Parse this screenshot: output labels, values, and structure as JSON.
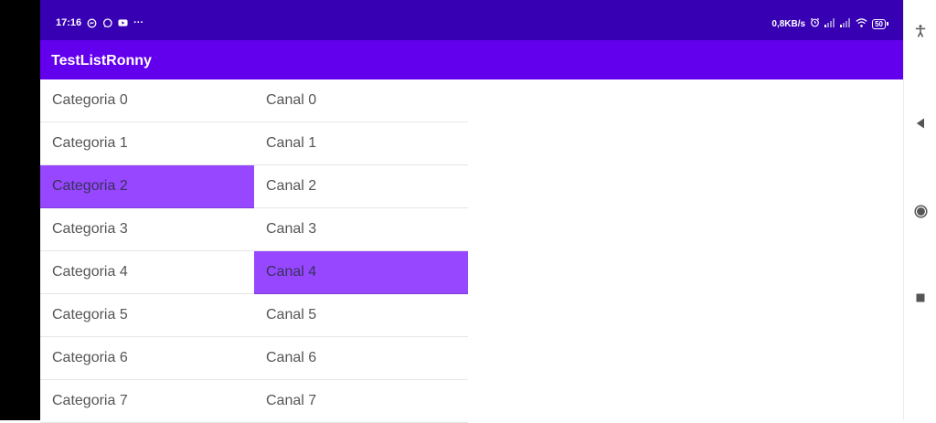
{
  "status_bar": {
    "time": "17:16",
    "overflow": "···",
    "net_speed": "0,8KB/s",
    "battery": "50",
    "icons_left": [
      "messenger-icon",
      "whatsapp-icon",
      "youtube-icon"
    ],
    "icons_right": [
      "alarm-icon",
      "signal-icon",
      "signal-icon",
      "wifi-icon",
      "battery-icon"
    ]
  },
  "app_bar": {
    "title": "TestListRonny",
    "color": "#6200ee"
  },
  "lists": {
    "selected_color": "#9747ff",
    "categories": [
      {
        "label": "Categoria 0",
        "selected": false
      },
      {
        "label": "Categoria 1",
        "selected": false
      },
      {
        "label": "Categoria 2",
        "selected": true
      },
      {
        "label": "Categoria 3",
        "selected": false
      },
      {
        "label": "Categoria 4",
        "selected": false
      },
      {
        "label": "Categoria 5",
        "selected": false
      },
      {
        "label": "Categoria 6",
        "selected": false
      },
      {
        "label": "Categoria 7",
        "selected": false
      }
    ],
    "canals": [
      {
        "label": "Canal 0",
        "selected": false
      },
      {
        "label": "Canal 1",
        "selected": false
      },
      {
        "label": "Canal 2",
        "selected": false
      },
      {
        "label": "Canal 3",
        "selected": false
      },
      {
        "label": "Canal 4",
        "selected": true
      },
      {
        "label": "Canal 5",
        "selected": false
      },
      {
        "label": "Canal 6",
        "selected": false
      },
      {
        "label": "Canal 7",
        "selected": false
      }
    ]
  },
  "nav_bar": {
    "icons": [
      "accessibility-icon",
      "back-icon",
      "home-icon",
      "recents-icon"
    ]
  }
}
